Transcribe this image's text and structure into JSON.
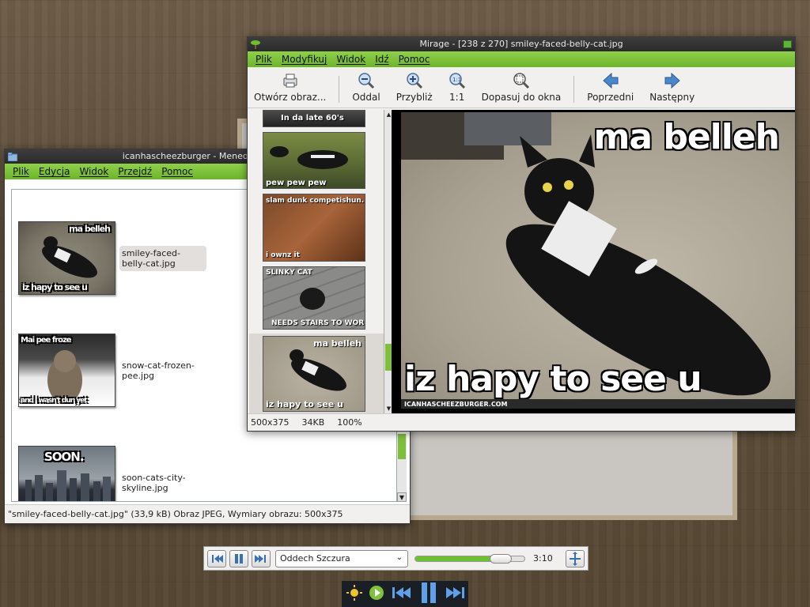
{
  "desktop": {
    "background_color": "#64533f"
  },
  "filemanager": {
    "title": "icanhascheezburger - Menedżer plików",
    "menu": [
      "Plik",
      "Edycja",
      "Widok",
      "Przejdź",
      "Pomoc"
    ],
    "files": [
      {
        "name": "smiley-faced-belly-cat.jpg",
        "top_caption": "ma belleh",
        "bottom_caption": "iz hapy to see u",
        "selected": true
      },
      {
        "name": "snow-cat-frozen-pee.jpg",
        "top_caption": "Mai pee froze",
        "bottom_caption": "and I wasn't dun yet",
        "selected": false
      },
      {
        "name": "soon-cats-city-skyline.jpg",
        "top_caption": "SOON.",
        "bottom_caption": "",
        "selected": false
      }
    ],
    "status": "\"smiley-faced-belly-cat.jpg\" (33,9 kB) Obraz JPEG, Wymiary obrazu: 500x375"
  },
  "mirage": {
    "title": "Mirage - [238 z 270] smiley-faced-belly-cat.jpg",
    "menu": [
      "Plik",
      "Modyfikuj",
      "Widok",
      "Idź",
      "Pomoc"
    ],
    "toolbar": {
      "open": "Otwórz obraz...",
      "zoom_out": "Oddal",
      "zoom_in": "Przybliż",
      "zoom_1_1": "1:1",
      "fit": "Dopasuj do okna",
      "prev": "Poprzedni",
      "next": "Następny"
    },
    "thumbnails": [
      {
        "caption_top": "In da late 60's",
        "caption_bottom": ""
      },
      {
        "caption_top": "",
        "caption_bottom": "pew pew pew"
      },
      {
        "caption_top": "slam dunk competishun...",
        "caption_bottom": "i ownz it"
      },
      {
        "caption_top": "SLINKY CAT",
        "caption_bottom": "NEEDS STAIRS TO WORK"
      },
      {
        "caption_top": "ma belleh",
        "caption_bottom": "iz hapy to see u"
      }
    ],
    "image": {
      "top_caption": "ma belleh",
      "bottom_caption": "iz hapy to see u",
      "watermark": "ICANHASCHEEZBURGER.COM"
    },
    "status": {
      "dimensions": "500x375",
      "size": "34KB",
      "zoom": "100%"
    }
  },
  "player": {
    "track": "Oddech Szczura",
    "time": "3:10",
    "progress": 0.78
  },
  "colors": {
    "accent_green": "#7fc23c",
    "title_bar": "#2f2f2f"
  }
}
